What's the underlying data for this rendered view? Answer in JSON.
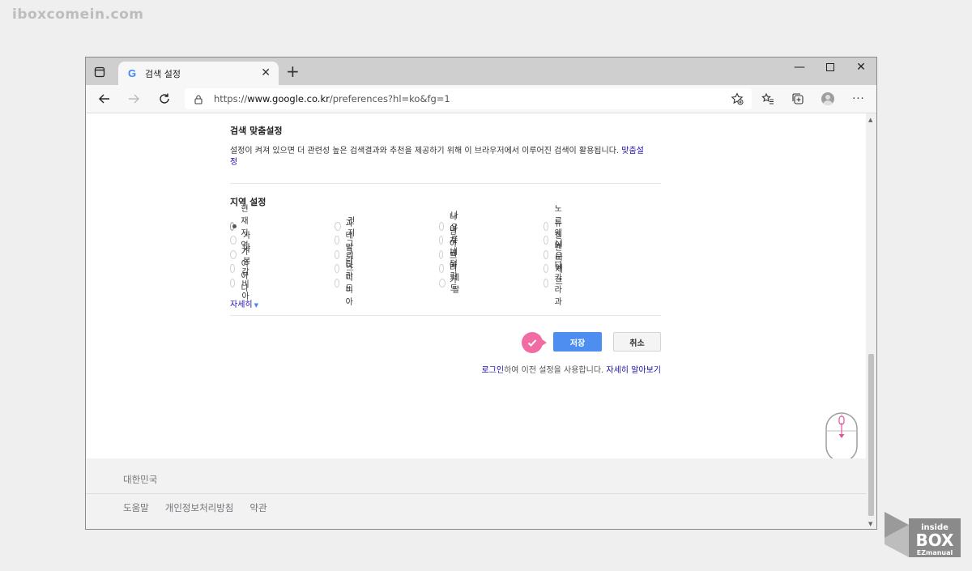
{
  "watermark": "iboxcomein.com",
  "browser": {
    "tab_title": "검색 설정",
    "url_prefix": "https://",
    "url_host": "www.google.co.kr",
    "url_path": "/preferences?hl=ko&fg=1"
  },
  "personalization": {
    "heading": "검색 맞춤설정",
    "description": "설정이 켜져 있으면 더 관련성 높은 검색결과와 추천을 제공하기 위해 이 브라우저에서 이루어진 검색이 활용됩니다.",
    "link": "맞춤설정"
  },
  "region": {
    "heading": "지역 설정",
    "columns": [
      [
        "현재 지역",
        "가나",
        "가봉",
        "가이아나",
        "감비아"
      ],
      [
        "건지",
        "과테말라",
        "그리스",
        "그린란드",
        "나미비아"
      ],
      [
        "나우루",
        "나이지리아",
        "남아프리카",
        "네덜란드",
        "네팔"
      ],
      [
        "노르웨이",
        "뉴질랜드",
        "니우에",
        "니제르",
        "니카라과"
      ]
    ],
    "selected": "현재 지역",
    "more_label": "자세히"
  },
  "actions": {
    "save_label": "저장",
    "cancel_label": "취소",
    "login_link": "로그인",
    "login_text": "하여 이전 설정을 사용합니다.",
    "learn_more": "자세히 알아보기"
  },
  "footer": {
    "country": "대한민국",
    "links": [
      "도움말",
      "개인정보처리방침",
      "약관"
    ]
  },
  "corner_logo": {
    "line1": "inside",
    "line2": "BOX",
    "line3": "EZmanual"
  },
  "colors": {
    "accent": "#4d8ef0",
    "link": "#1a0dab",
    "badge": "#f06ca2"
  }
}
